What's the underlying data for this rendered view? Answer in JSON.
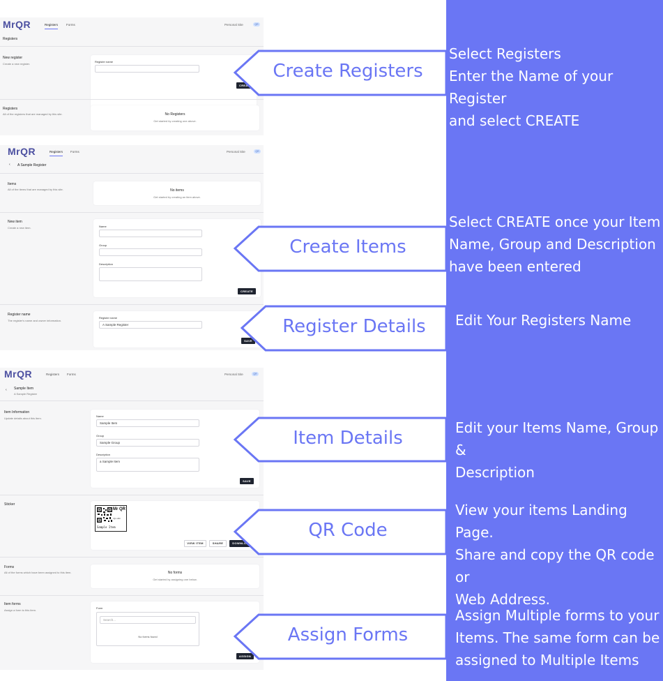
{
  "panel_color": "#6a76f4",
  "app": {
    "logo": "MrQR",
    "nav_registers": "Registers",
    "nav_forms": "Forms",
    "site": "Personal Site",
    "avatar": "QR"
  },
  "screen1": {
    "page_title": "Registers",
    "new_register_title": "New register",
    "new_register_desc": "Create a new register.",
    "register_name_label": "Register name",
    "create_btn": "CREATE",
    "registers_title": "Registers",
    "registers_desc": "All of the registers that are managed by this site.",
    "empty_title": "No Registers",
    "empty_desc": "Get started by creating one above."
  },
  "screen2": {
    "page_title": "A Sample Register",
    "items_title": "Items",
    "items_desc": "All of the items that are managed by this site.",
    "empty_title": "No items",
    "empty_desc": "Get started by creating an item above.",
    "new_item_title": "New item",
    "new_item_desc": "Create a new item.",
    "name_label": "Name",
    "group_label": "Group",
    "description_label": "Description",
    "create_btn": "CREATE",
    "register_name_title": "Register name",
    "register_name_desc": "The register's name and owner information.",
    "register_name_label": "Register name",
    "register_name_value": "A Sample Register",
    "save_btn": "SAVE"
  },
  "screen3": {
    "page_title": "Sample Item",
    "page_subtitle": "A Sample Register",
    "info_title": "Item Information",
    "info_desc": "Update details about this item.",
    "name_label": "Name",
    "name_value": "Sample Item",
    "group_label": "Group",
    "group_value": "Sample Group",
    "description_label": "Description",
    "description_value": "a Sample Item",
    "save_btn": "SAVE",
    "sticker_title": "Sticker",
    "sticker_brand": "Mr QR",
    "sticker_code": "rQr-shhi",
    "sticker_caption": "Sample Item",
    "view_item_btn": "VIEW ITEM",
    "share_btn": "SHARE",
    "download_btn": "DOWNLOAD",
    "forms_title": "Forms",
    "forms_desc": "All of the forms which have been assigned to this item.",
    "forms_empty_title": "No forms",
    "forms_empty_desc": "Get started by assigning one below.",
    "item_forms_title": "Item forms",
    "item_forms_desc": "Assign a form to this item.",
    "form_label": "Form",
    "search_placeholder": "Search...",
    "no_forms_found": "No forms found",
    "assign_btn": "ASSIGN"
  },
  "callouts": [
    {
      "label": "Create Registers",
      "text": "Select Registers\nEnter the Name of your Register\nand select CREATE"
    },
    {
      "label": "Create Items",
      "text": "Select CREATE once your Item\nName, Group and Description\nhave been entered"
    },
    {
      "label": "Register Details",
      "text": "Edit Your Registers Name"
    },
    {
      "label": "Item Details",
      "text": "Edit your Items Name, Group &\nDescription"
    },
    {
      "label": "QR Code",
      "text": "View your items Landing Page.\nShare and copy the QR code or\nWeb Address."
    },
    {
      "label": "Assign Forms",
      "text": "Assign Multiple forms to your\nItems. The same form can be\nassigned to Multiple Items"
    }
  ]
}
